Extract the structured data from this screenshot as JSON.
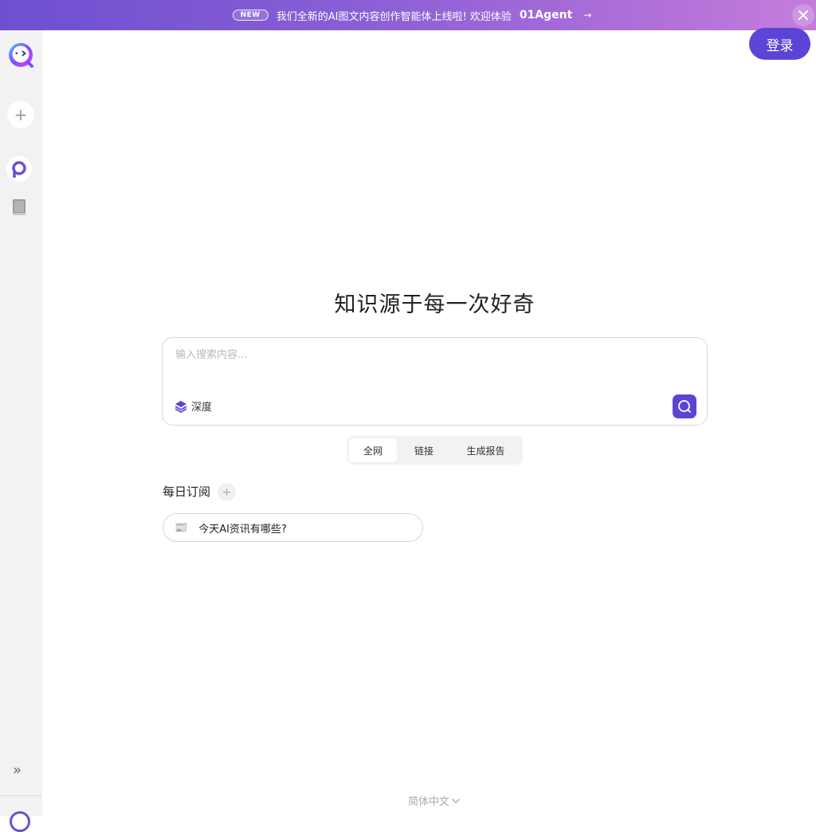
{
  "banner": {
    "badge": "NEW",
    "text": "我们全新的AI图文内容创作智能体上线啦! 欢迎体验",
    "agent": "01Agent",
    "arrow": "→"
  },
  "header": {
    "login_label": "登录"
  },
  "sidebar": {
    "new_symbol": "+",
    "expand_symbol": "»"
  },
  "main": {
    "title": "知识源于每一次好奇",
    "search": {
      "placeholder": "输入搜索内容...",
      "value": "",
      "depth_label": "深度"
    },
    "tabs": [
      {
        "label": "全网",
        "active": true
      },
      {
        "label": "链接",
        "active": false
      },
      {
        "label": "生成报告",
        "active": false
      }
    ],
    "subscriptions": {
      "title": "每日订阅",
      "add_symbol": "+",
      "items": [
        {
          "icon": "📰",
          "label": "今天AI资讯有哪些?"
        }
      ]
    }
  },
  "footer": {
    "language": "简体中文"
  },
  "colors": {
    "accent": "#5b45d6",
    "banner_start": "#6d4fd0",
    "banner_end": "#c47ddc",
    "sidebar_bg": "#f2f2f3"
  },
  "icons": {
    "logo": "bot-logo-icon",
    "new": "plus-icon",
    "explore": "explore-icon",
    "library": "book-icon",
    "expand": "double-chevron-right-icon",
    "search": "search-icon",
    "depth": "layers-icon",
    "close": "close-icon",
    "language_dropdown": "chevron-down-icon"
  }
}
